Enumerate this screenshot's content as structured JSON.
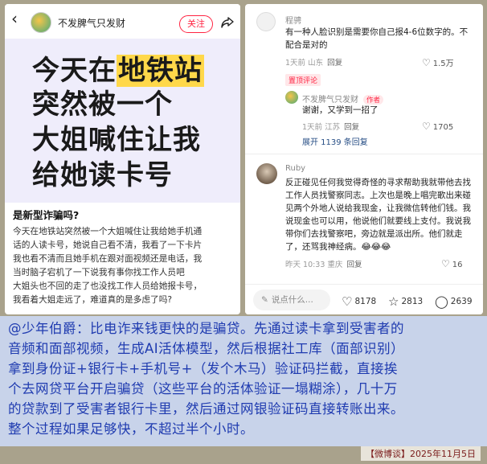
{
  "post": {
    "author": "不发脾气只发财",
    "follow_label": "关注",
    "cover_lines": [
      {
        "pre": "今天在",
        "hl": "地铁站",
        "post": ""
      },
      {
        "pre": "突然被一个",
        "hl": "",
        "post": ""
      },
      {
        "pre": "大姐喊住让我",
        "hl": "",
        "post": ""
      },
      {
        "pre": "给她读卡号",
        "hl": "",
        "post": ""
      }
    ],
    "title": "是新型诈骗吗?",
    "body_lines": [
      "今天在地铁站突然被一个大姐喊住让我给她手机通",
      "话的人读卡号，她说自己看不清，我看了一下卡片",
      "我也看不清而且她手机在跟对面视频还是电话，我",
      "当时脑子宕机了一下说我有事你找工作人员吧",
      "大姐头也不回的走了也没找工作人员给她报卡号，",
      "我看着大姐走远了，难道真的是多虑了吗?"
    ]
  },
  "comments": [
    {
      "name": "程骋",
      "lines": [
        "有一种人脸识别是需要你自己报4-6位数字的。不",
        "配合是对的"
      ],
      "meta": "1天前 山东",
      "reply": "回复",
      "likes": "1.5万",
      "badge": "置顶评论"
    },
    {
      "name": "不发脾气只发财",
      "tag": "作者",
      "lines": [
        "谢谢，又学到一招了"
      ],
      "meta": "1天前 江苏",
      "reply": "回复",
      "likes": "1705",
      "expand": "展开 1139 条回复"
    },
    {
      "name": "Ruby",
      "lines": [
        "反正碰见任何我觉得奇怪的寻求帮助我就带他去找",
        "工作人员找警察同志。上次也是晚上唱完歌出来碰",
        "见两个外地人说给我现金，让我微信转他们钱。我",
        "说现金也可以用，他说他们就要线上支付。我说我",
        "带你们去找警察吧，旁边就是派出所。他们就走",
        "了，还骂我神经病。😂😂😂"
      ],
      "meta": "昨天 10:33 重庆",
      "reply": "回复",
      "likes": "16"
    }
  ],
  "bottom_bar": {
    "say_placeholder": "说点什么...",
    "likes": "8178",
    "stars": "2813",
    "comments": "2639"
  },
  "caption": {
    "lines": [
      "@少年伯爵：比电诈来钱更快的是骗贷。先通过读卡拿到受害者的",
      "音频和面部视频，生成AI活体模型，然后根据社工库（面部识别）",
      "拿到身份证+银行卡+手机号+（发个木马）验证码拦截，直接挨",
      "个去网贷平台开启骗贷（这些平台的活体验证一塌糊涂），几十万",
      "的贷款到了受害者银行卡里，然后通过网银验证码直接转账出来。",
      "整个过程如果足够快，不超过半个小时。"
    ],
    "date": "【微博谈】2025年11月5日"
  },
  "colors": {
    "accent": "#ff2442",
    "highlight": "#ffd84a",
    "caption_text": "#1f3bb0",
    "caption_bg": "#c8d3ea"
  }
}
